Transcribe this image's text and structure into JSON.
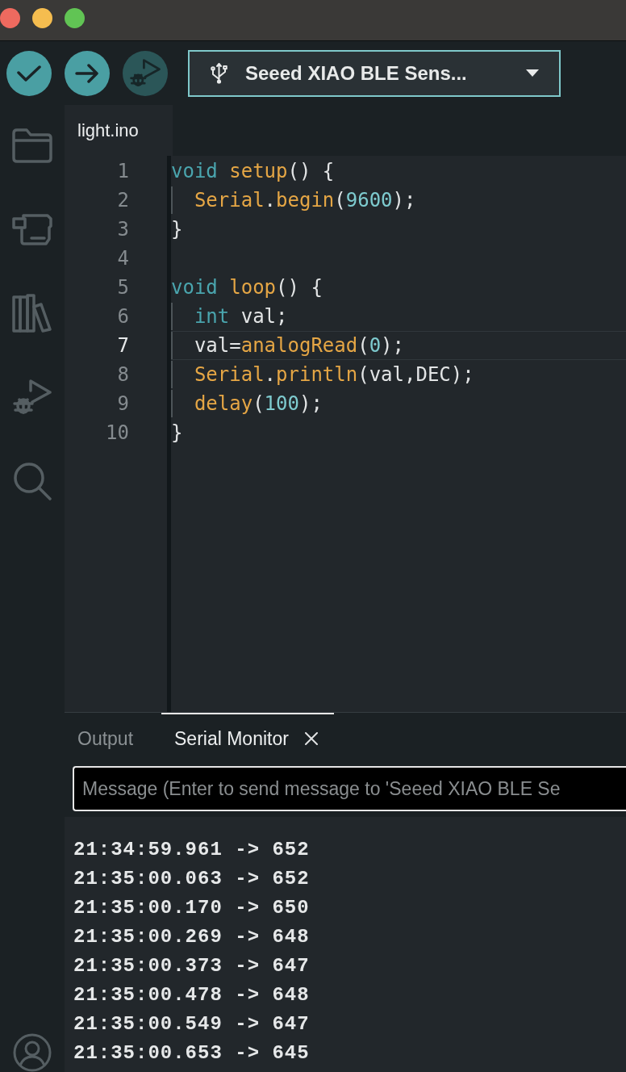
{
  "toolbar": {
    "buttons": [
      {
        "kind": "verify",
        "disabled": false
      },
      {
        "kind": "upload",
        "disabled": false
      },
      {
        "kind": "debug",
        "disabled": true
      }
    ],
    "board_selector": {
      "label": "Seeed XIAO BLE Sens..."
    }
  },
  "sidebar": {
    "items": [
      {
        "kind": "sketchbook",
        "selected": false
      },
      {
        "kind": "boards",
        "selected": false
      },
      {
        "kind": "library",
        "selected": false
      },
      {
        "kind": "debug",
        "selected": false
      },
      {
        "kind": "search",
        "selected": false
      }
    ]
  },
  "editor": {
    "tabs": [
      {
        "label": "light.ino",
        "selected": true
      }
    ],
    "lines": [
      {
        "number": "1",
        "current": false,
        "tokens": [
          {
            "kind": "keyword",
            "text": "void"
          },
          {
            "kind": "function",
            "text": " setup"
          },
          {
            "kind": "plain",
            "text": "() {"
          }
        ]
      },
      {
        "number": "2",
        "current": false,
        "tokens": [
          {
            "kind": "function",
            "text": "  Serial"
          },
          {
            "kind": "member",
            "text": ".begin"
          },
          {
            "kind": "plain",
            "text": "("
          },
          {
            "kind": "number",
            "text": "9600"
          },
          {
            "kind": "plain",
            "text": ");"
          }
        ]
      },
      {
        "number": "3",
        "current": false,
        "tokens": [
          {
            "kind": "plain",
            "text": "}"
          }
        ]
      },
      {
        "number": "4",
        "current": false
      },
      {
        "number": "5",
        "current": false,
        "tokens": [
          {
            "kind": "keyword",
            "text": "void"
          },
          {
            "kind": "function",
            "text": " loop"
          },
          {
            "kind": "plain",
            "text": "() {"
          }
        ]
      },
      {
        "number": "6",
        "current": false,
        "tokens": [
          {
            "kind": "keyword",
            "text": "  int"
          },
          {
            "kind": "plain",
            "text": " val;"
          }
        ]
      },
      {
        "number": "7",
        "current": true,
        "tokens": [
          {
            "kind": "plain",
            "text": "  val="
          },
          {
            "kind": "function",
            "text": "analogRead"
          },
          {
            "kind": "plain",
            "text": "("
          },
          {
            "kind": "number",
            "text": "0"
          },
          {
            "kind": "plain",
            "text": ");"
          }
        ]
      },
      {
        "number": "8",
        "current": false,
        "tokens": [
          {
            "kind": "function",
            "text": "  Serial"
          },
          {
            "kind": "member",
            "text": ".println"
          },
          {
            "kind": "plain",
            "text": "(val,DEC);"
          }
        ]
      },
      {
        "number": "9",
        "current": false,
        "tokens": [
          {
            "kind": "function",
            "text": "  delay"
          },
          {
            "kind": "plain",
            "text": "("
          },
          {
            "kind": "number",
            "text": "100"
          },
          {
            "kind": "plain",
            "text": ");"
          }
        ]
      },
      {
        "number": "10",
        "current": false,
        "tokens": [
          {
            "kind": "plain",
            "text": "}"
          }
        ]
      }
    ]
  },
  "panel": {
    "tabs": [
      {
        "label": "Output",
        "selected": false,
        "closable": false
      },
      {
        "label": "Serial Monitor",
        "selected": true,
        "closable": true
      }
    ],
    "message_field": {
      "placeholder": "Message (Enter to send message to 'Seeed XIAO BLE Se"
    },
    "serial_output": [
      "21:34:59.961 -> 652",
      "21:35:00.063 -> 652",
      "21:35:00.170 -> 650",
      "21:35:00.269 -> 648",
      "21:35:00.373 -> 647",
      "21:35:00.478 -> 648",
      "21:35:00.549 -> 647",
      "21:35:00.653 -> 645"
    ]
  }
}
